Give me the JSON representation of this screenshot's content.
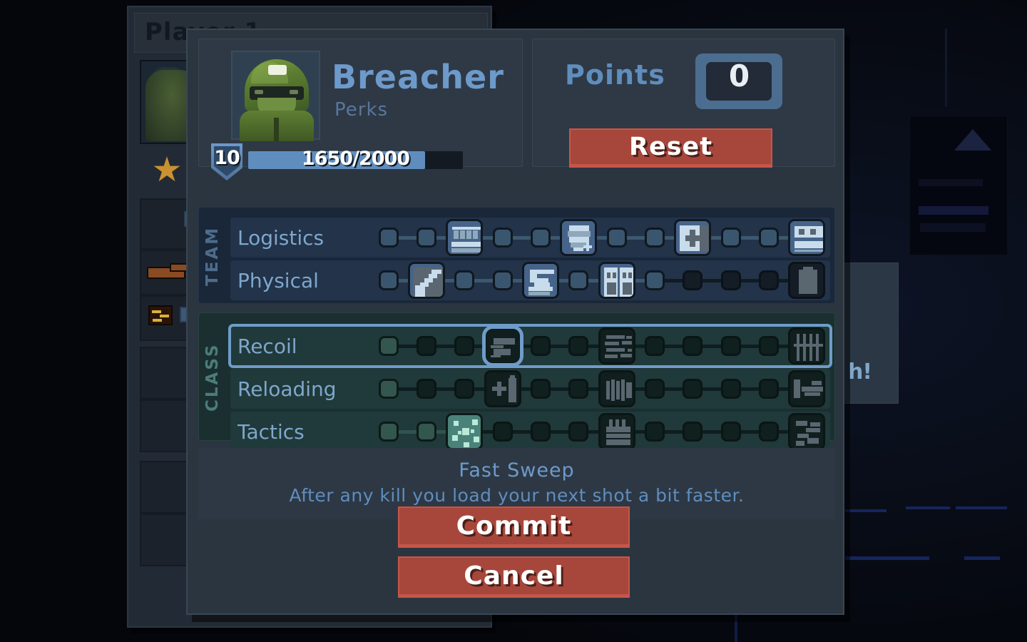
{
  "background": {
    "player_window": {
      "title": "Player 1",
      "gamepad_icon": "gamepad-icon",
      "rank_icon": "star-icon"
    },
    "sign_text": "h!"
  },
  "modal": {
    "character": {
      "name": "Breacher",
      "subtitle": "Perks",
      "portrait_icon": "soldier-portrait",
      "level": "10",
      "xp_text": "1650/2000",
      "xp_current": 1650,
      "xp_max": 2000,
      "xp_percent": 82.5
    },
    "points": {
      "label": "Points",
      "value": "0",
      "reset_label": "Reset"
    },
    "groups": [
      {
        "label": "TEAM",
        "rows": [
          {
            "name": "Logistics",
            "selected": false,
            "nodes": [
              {
                "type": "node",
                "state": "on"
              },
              {
                "type": "node",
                "state": "on"
              },
              {
                "type": "icon",
                "state": "unlocked",
                "icon": "ammo-crate-icon"
              },
              {
                "type": "node",
                "state": "on"
              },
              {
                "type": "node",
                "state": "on"
              },
              {
                "type": "icon",
                "state": "unlocked",
                "icon": "armor-plus-icon"
              },
              {
                "type": "node",
                "state": "on"
              },
              {
                "type": "node",
                "state": "on"
              },
              {
                "type": "icon",
                "state": "unlocked",
                "icon": "medkit-icon"
              },
              {
                "type": "node",
                "state": "on"
              },
              {
                "type": "node",
                "state": "on"
              },
              {
                "type": "icon",
                "state": "unlocked",
                "icon": "radio-icon"
              }
            ]
          },
          {
            "name": "Physical",
            "selected": false,
            "nodes": [
              {
                "type": "node",
                "state": "on"
              },
              {
                "type": "icon",
                "state": "unlocked",
                "icon": "shield-knife-icon"
              },
              {
                "type": "node",
                "state": "on"
              },
              {
                "type": "node",
                "state": "on"
              },
              {
                "type": "icon",
                "state": "unlocked",
                "icon": "sprint-icon"
              },
              {
                "type": "node",
                "state": "on"
              },
              {
                "type": "icon",
                "state": "unlocked",
                "icon": "doors-icon"
              },
              {
                "type": "node",
                "state": "on"
              },
              {
                "type": "node",
                "state": "off"
              },
              {
                "type": "node",
                "state": "off"
              },
              {
                "type": "node",
                "state": "off"
              },
              {
                "type": "icon",
                "state": "locked",
                "icon": "backpack-icon"
              }
            ]
          }
        ]
      },
      {
        "label": "CLASS",
        "rows": [
          {
            "name": "Recoil",
            "selected": true,
            "nodes": [
              {
                "type": "node",
                "state": "on"
              },
              {
                "type": "node",
                "state": "off"
              },
              {
                "type": "node",
                "state": "off"
              },
              {
                "type": "icon",
                "state": "locked",
                "icon": "recoil-kick-icon",
                "highlight": true
              },
              {
                "type": "node",
                "state": "off"
              },
              {
                "type": "node",
                "state": "off"
              },
              {
                "type": "icon",
                "state": "locked",
                "icon": "spread-icon"
              },
              {
                "type": "node",
                "state": "off"
              },
              {
                "type": "node",
                "state": "off"
              },
              {
                "type": "node",
                "state": "off"
              },
              {
                "type": "node",
                "state": "off"
              },
              {
                "type": "icon",
                "state": "locked",
                "icon": "rake-icon"
              }
            ]
          },
          {
            "name": "Reloading",
            "selected": false,
            "nodes": [
              {
                "type": "node",
                "state": "on"
              },
              {
                "type": "node",
                "state": "off"
              },
              {
                "type": "node",
                "state": "off"
              },
              {
                "type": "icon",
                "state": "locked",
                "icon": "mag-plus-icon"
              },
              {
                "type": "node",
                "state": "off"
              },
              {
                "type": "node",
                "state": "off"
              },
              {
                "type": "icon",
                "state": "locked",
                "icon": "shells-icon"
              },
              {
                "type": "node",
                "state": "off"
              },
              {
                "type": "node",
                "state": "off"
              },
              {
                "type": "node",
                "state": "off"
              },
              {
                "type": "node",
                "state": "off"
              },
              {
                "type": "icon",
                "state": "locked",
                "icon": "fast-reload-icon"
              }
            ]
          },
          {
            "name": "Tactics",
            "selected": false,
            "nodes": [
              {
                "type": "node",
                "state": "on"
              },
              {
                "type": "node",
                "state": "on"
              },
              {
                "type": "icon",
                "state": "unlocked",
                "icon": "scatter-icon"
              },
              {
                "type": "node",
                "state": "off"
              },
              {
                "type": "node",
                "state": "off"
              },
              {
                "type": "node",
                "state": "off"
              },
              {
                "type": "icon",
                "state": "locked",
                "icon": "grenade-pack-icon"
              },
              {
                "type": "node",
                "state": "off"
              },
              {
                "type": "node",
                "state": "off"
              },
              {
                "type": "node",
                "state": "off"
              },
              {
                "type": "node",
                "state": "off"
              },
              {
                "type": "icon",
                "state": "locked",
                "icon": "deflect-icon"
              }
            ]
          }
        ]
      }
    ],
    "description": {
      "title": "Fast Sweep",
      "text": "After any kill you load your next shot a bit faster."
    },
    "footer": {
      "commit_label": "Commit",
      "cancel_label": "Cancel"
    }
  },
  "colors": {
    "accent_blue": "#6d9acb",
    "accent_teal": "#4a8279",
    "button_red": "#a7473b",
    "panel": "#2b3540",
    "team_panel": "#1a2738",
    "class_panel": "#1b2f30"
  }
}
